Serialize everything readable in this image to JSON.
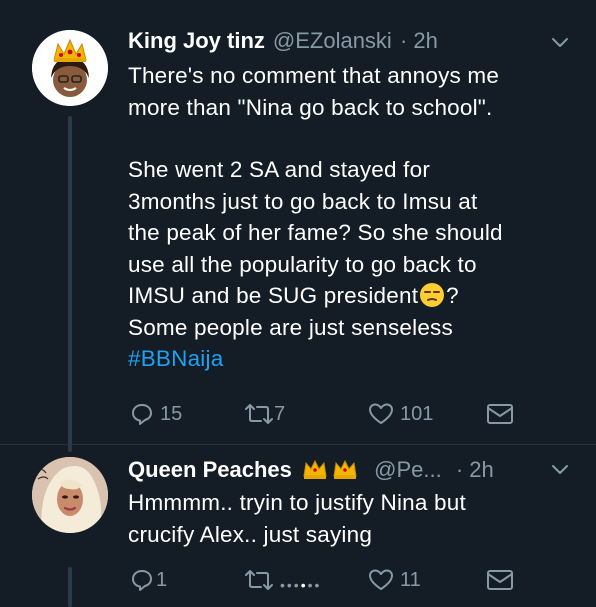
{
  "tweets": [
    {
      "name": "King Joy tinz",
      "handle": "@EZolanski",
      "time": "· 2h",
      "lines": [
        "There's no comment that annoys me",
        "more than \"Nina go back to school\"."
      ],
      "lines2": [
        "She went 2 SA and stayed for",
        "3months just to go back to Imsu at",
        "the peak of her fame? So she should",
        "use all the popularity to go back to"
      ],
      "line_emoji_before": "IMSU and be SUG president",
      "line_emoji_after": "?",
      "line_last": "Some people are just senseless",
      "hashtag": "#BBNaija",
      "replies": "15",
      "retweets": "7",
      "likes": "101"
    },
    {
      "name": "Queen Peaches",
      "handle": "@Pe...",
      "time": "· 2h",
      "lines": [
        "Hmmmm.. tryin to justify Nina but",
        "crucify Alex.. just saying"
      ],
      "replies": "1",
      "retweets": "",
      "likes": "11"
    }
  ],
  "icons": {
    "reply": "reply-icon",
    "retweet": "retweet-icon",
    "like": "heart-icon",
    "dm": "envelope-icon",
    "chevron": "chevron-down-icon"
  },
  "colors": {
    "background": "#141d26",
    "text": "#ffffff",
    "muted": "#8899a6",
    "link": "#1da1f2"
  }
}
